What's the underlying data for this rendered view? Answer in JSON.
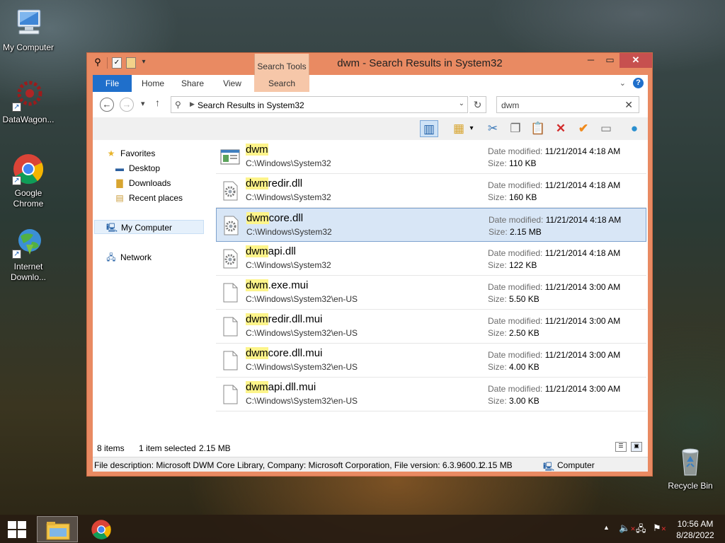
{
  "desktop": {
    "icons": [
      {
        "label": "My Computer"
      },
      {
        "label": "DataWagon..."
      },
      {
        "label": "Google Chrome"
      },
      {
        "label": "Internet Downlo..."
      },
      {
        "label": "Recycle Bin"
      }
    ]
  },
  "window": {
    "title": "dwm - Search Results in System32",
    "context_tab_group": "Search Tools",
    "ribbon_tabs": [
      "File",
      "Home",
      "Share",
      "View",
      "Search"
    ],
    "address": "Search Results in System32",
    "search_value": "dwm"
  },
  "navpane": {
    "favorites": "Favorites",
    "desktop": "Desktop",
    "downloads": "Downloads",
    "recent": "Recent places",
    "my_computer": "My Computer",
    "network": "Network"
  },
  "results": {
    "date_label": "Date modified:",
    "size_label": "Size:",
    "items": [
      {
        "match": "dwm",
        "rest": "",
        "path": "C:\\Windows\\System32",
        "date": "11/21/2014 4:18 AM",
        "size": "110 KB",
        "icon": "application-icon",
        "selected": false
      },
      {
        "match": "dwm",
        "rest": "redir.dll",
        "path": "C:\\Windows\\System32",
        "date": "11/21/2014 4:18 AM",
        "size": "160 KB",
        "icon": "dll-gear-icon",
        "selected": false
      },
      {
        "match": "dwm",
        "rest": "core.dll",
        "path": "C:\\Windows\\System32",
        "date": "11/21/2014 4:18 AM",
        "size": "2.15 MB",
        "icon": "dll-gear-icon",
        "selected": true
      },
      {
        "match": "dwm",
        "rest": "api.dll",
        "path": "C:\\Windows\\System32",
        "date": "11/21/2014 4:18 AM",
        "size": "122 KB",
        "icon": "dll-gear-icon",
        "selected": false
      },
      {
        "match": "dwm",
        "rest": ".exe.mui",
        "path": "C:\\Windows\\System32\\en-US",
        "date": "11/21/2014 3:00 AM",
        "size": "5.50 KB",
        "icon": "blank-file-icon",
        "selected": false
      },
      {
        "match": "dwm",
        "rest": "redir.dll.mui",
        "path": "C:\\Windows\\System32\\en-US",
        "date": "11/21/2014 3:00 AM",
        "size": "2.50 KB",
        "icon": "blank-file-icon",
        "selected": false
      },
      {
        "match": "dwm",
        "rest": "core.dll.mui",
        "path": "C:\\Windows\\System32\\en-US",
        "date": "11/21/2014 3:00 AM",
        "size": "4.00 KB",
        "icon": "blank-file-icon",
        "selected": false
      },
      {
        "match": "dwm",
        "rest": "api.dll.mui",
        "path": "C:\\Windows\\System32\\en-US",
        "date": "11/21/2014 3:00 AM",
        "size": "3.00 KB",
        "icon": "blank-file-icon",
        "selected": false
      }
    ]
  },
  "status": {
    "count": "8 items",
    "selection": "1 item selected",
    "selection_size": "2.15 MB"
  },
  "details": {
    "description": "File description: Microsoft DWM Core Library, Company: Microsoft Corporation, File version: 6.3.9600.1",
    "size": "2.15 MB",
    "location": "Computer"
  },
  "taskbar": {
    "time": "10:56 AM",
    "date": "8/28/2022"
  },
  "colors": {
    "window_frame": "#e98a62",
    "close_button": "#c7504f",
    "file_tab": "#1f6fcb",
    "context_tab": "#f6c7a9",
    "search_highlight": "#fdf48a",
    "selection": "#d8e6f6"
  }
}
